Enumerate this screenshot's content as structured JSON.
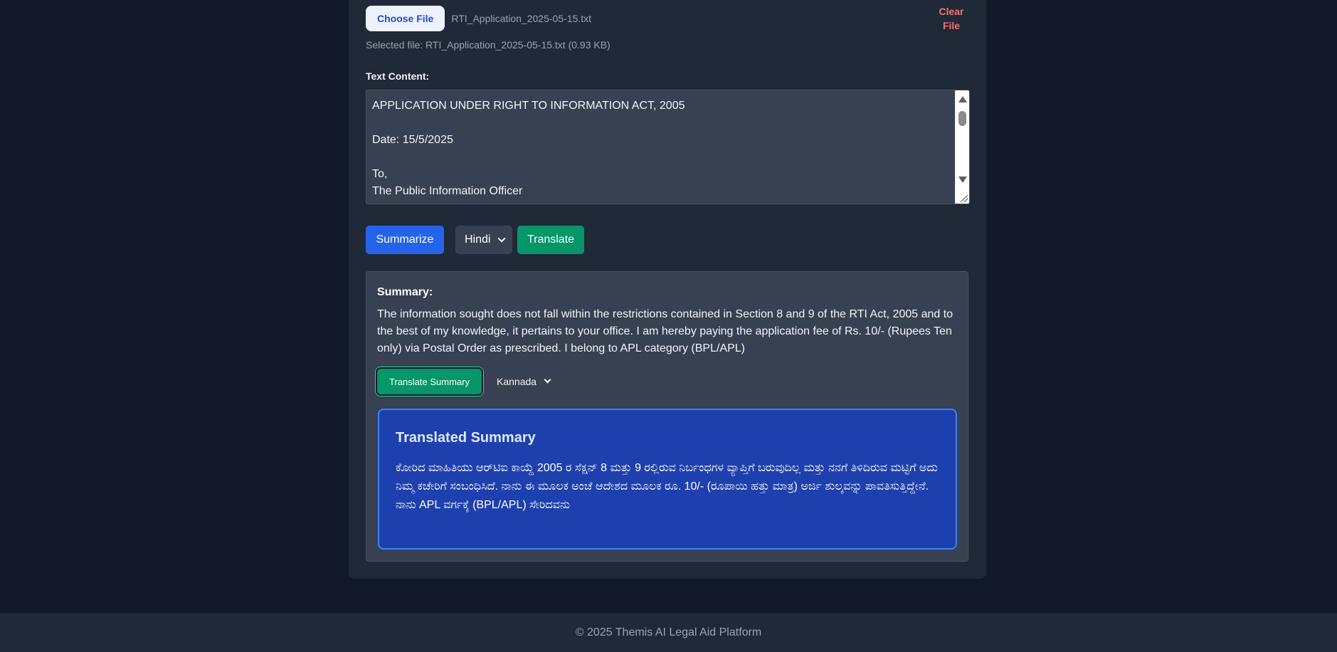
{
  "upload": {
    "choose_label": "Choose File",
    "file_name": "RTI_Application_2025-05-15.txt",
    "clear_label": "Clear File",
    "selected_info": "Selected file: RTI_Application_2025-05-15.txt (0.93 KB)"
  },
  "text_content": {
    "label": "Text Content:",
    "value": "APPLICATION UNDER RIGHT TO INFORMATION ACT, 2005\n\nDate: 15/5/2025\n\nTo,\nThe Public Information Officer"
  },
  "actions": {
    "summarize_label": "Summarize",
    "language_selected": "Hindi",
    "translate_label": "Translate"
  },
  "summary": {
    "title": "Summary:",
    "text": "The information sought does not fall within the restrictions contained in Section 8 and 9 of the RTI Act, 2005 and to the best of my knowledge, it pertains to your office. I am hereby paying the application fee of Rs. 10/- (Rupees Ten only) via Postal Order as prescribed. I belong to APL category (BPL/APL)",
    "translate_summary_label": "Translate Summary",
    "summary_language_selected": "Kannada"
  },
  "translated": {
    "title": "Translated Summary",
    "text": "ಕೋರಿದ ಮಾಹಿತಿಯು ಆರ್‌ಟಿಐ ಕಾಯ್ದೆ 2005 ರ ಸೆಕ್ಷನ್ 8 ಮತ್ತು 9 ರಲ್ಲಿರುವ ನಿರ್ಬಂಧಗಳ ವ್ಯಾಪ್ತಿಗೆ ಬರುವುದಿಲ್ಲ ಮತ್ತು ನನಗೆ ತಿಳಿದಿರುವ ಮಟ್ಟಿಗೆ ಅದು ನಿಮ್ಮ ಕಚೇರಿಗೆ ಸಂಬಂಧಿಸಿದೆ. ನಾನು ಈ ಮೂಲಕ ಅಂಚೆ ಆದೇಶದ ಮೂಲಕ ರೂ. 10/- (ರೂಪಾಯಿ ಹತ್ತು ಮಾತ್ರ) ಅರ್ಜಿ ಶುಲ್ಕವನ್ನು ಪಾವತಿಸುತ್ತಿದ್ದೇನೆ. ನಾನು APL ವರ್ಗಕ್ಕೆ (BPL/APL) ಸೇರಿದವನು"
  },
  "footer": {
    "text": "© 2025 Themis AI Legal Aid Platform"
  },
  "colors": {
    "page_bg": "#111827",
    "card_bg": "#1f2937",
    "primary_blue": "#2563eb",
    "green": "#059669",
    "danger": "#f87171",
    "translated_bg": "#1e40af"
  }
}
